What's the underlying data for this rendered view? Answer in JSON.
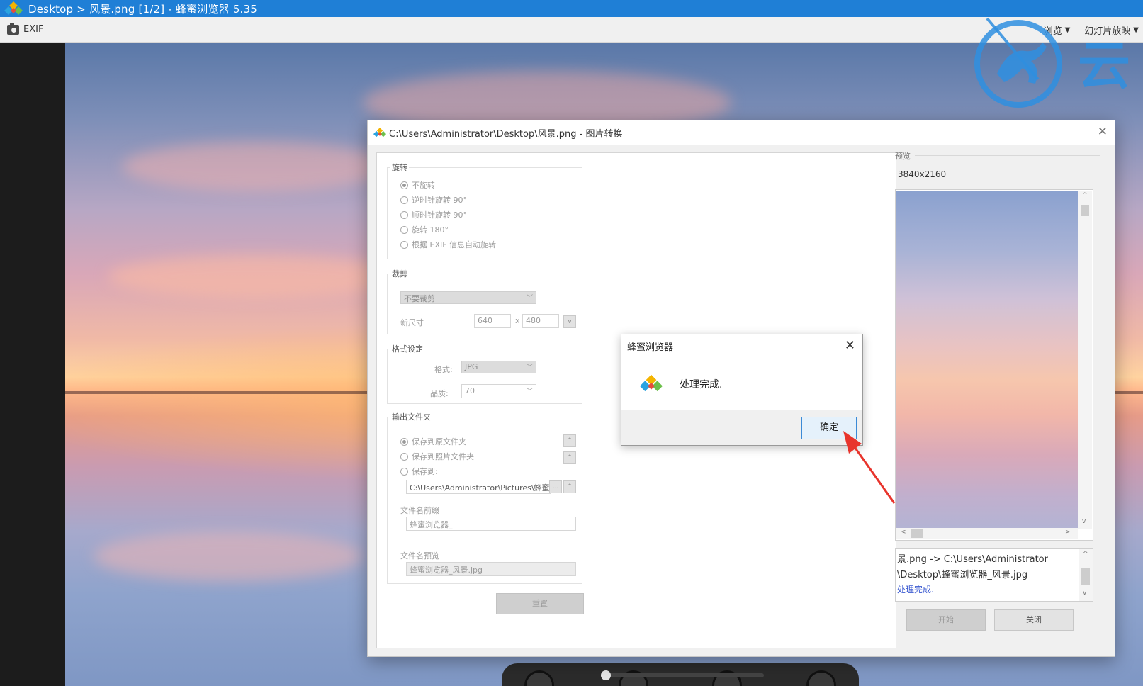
{
  "window": {
    "title": "Desktop > 风景.png [1/2] - 蜂蜜浏览器 5.35"
  },
  "toolbar": {
    "exif_label": "EXIF",
    "browse_label": "浏览",
    "slideshow_label": "幻灯片放映"
  },
  "watermark": {
    "text": "云"
  },
  "convert_dialog": {
    "title": "C:\\Users\\Administrator\\Desktop\\风景.png - 图片转换",
    "rotate": {
      "label": "旋转",
      "options": [
        "不旋转",
        "逆时针旋转 90°",
        "顺时针旋转 90°",
        "旋转 180°",
        "根据 EXIF 信息自动旋转"
      ],
      "selected_index": 0
    },
    "crop": {
      "label": "裁剪",
      "mode": "不要裁剪",
      "size_label": "新尺寸",
      "width": "640",
      "height": "480",
      "times": "x"
    },
    "format": {
      "label": "格式设定",
      "format_label": "格式:",
      "format_value": "JPG",
      "quality_label": "品质:",
      "quality_value": "70"
    },
    "output": {
      "label": "输出文件夹",
      "options": [
        "保存到原文件夹",
        "保存到照片文件夹",
        "保存到:"
      ],
      "selected_index": 0,
      "path": "C:\\Users\\Administrator\\Pictures\\蜂蜜浏",
      "browse_btn": "...",
      "prefix_label": "文件名前缀",
      "prefix_value": "蜂蜜浏览器_",
      "preview_label": "文件名预览",
      "preview_value": "蜂蜜浏览器_风景.jpg"
    },
    "reset_button": "重置",
    "preview": {
      "label": "预览",
      "size": "3840x2160"
    },
    "log": {
      "line1": "景.png -> C:\\Users\\Administrator",
      "line2": "\\Desktop\\蜂蜜浏览器_风景.jpg",
      "line3": "处理完成."
    },
    "start_button": "开始",
    "close_button": "关闭"
  },
  "message_box": {
    "title": "蜂蜜浏览器",
    "message": "处理完成.",
    "ok_button": "确定"
  },
  "colors": {
    "titlebar": "#1f7fd6",
    "annotation_arrow": "#e8342c",
    "log_done": "#3b5ad1"
  }
}
